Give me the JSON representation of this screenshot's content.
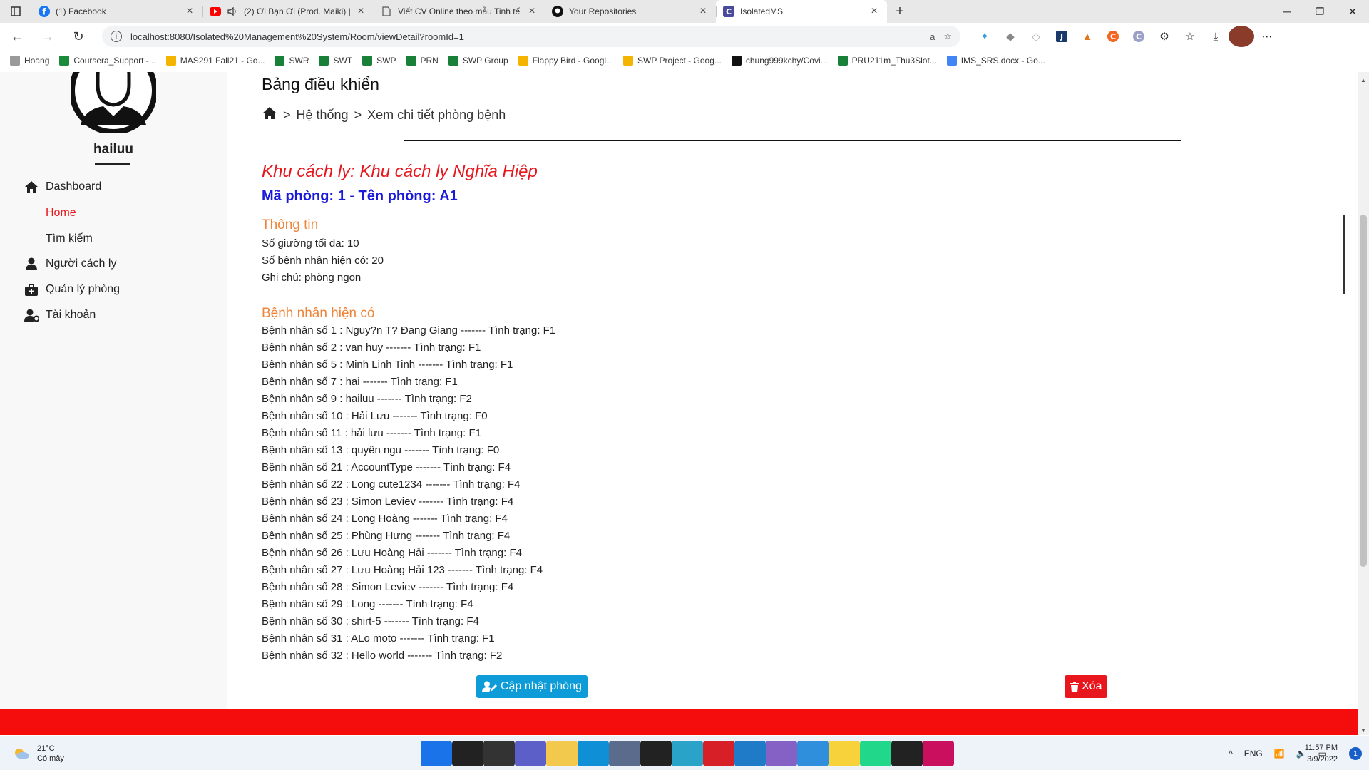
{
  "browser": {
    "tabs": [
      {
        "title": "(1) Facebook",
        "icon": "facebook-icon",
        "color": "#1877f2"
      },
      {
        "title": "(2) Ơi Bạn Ơi (Prod. Maiki) |",
        "icon": "youtube-icon",
        "color": "#ff0000"
      },
      {
        "title": "Viết CV Online theo mẫu Tinh tế",
        "icon": "page-icon",
        "color": "#555555"
      },
      {
        "title": "Your Repositories",
        "icon": "github-icon",
        "color": "#111111"
      },
      {
        "title": "IsolatedMS",
        "icon": "isolatedms-icon",
        "color": "#4a4a9c"
      }
    ],
    "url": "localhost:8080/Isolated%20Management%20System/Room/viewDetail?roomId=1",
    "bookmarks": [
      {
        "label": "Hoang",
        "color": "#999999"
      },
      {
        "label": "Coursera_Support -...",
        "color": "#1b8a3a"
      },
      {
        "label": "MAS291 Fall21 - Go...",
        "color": "#f4b400"
      },
      {
        "label": "SWR",
        "color": "#188038"
      },
      {
        "label": "SWT",
        "color": "#188038"
      },
      {
        "label": "SWP",
        "color": "#188038"
      },
      {
        "label": "PRN",
        "color": "#188038"
      },
      {
        "label": "SWP Group",
        "color": "#188038"
      },
      {
        "label": "Flappy Bird - Googl...",
        "color": "#f4b400"
      },
      {
        "label": "SWP Project - Goog...",
        "color": "#f4b400"
      },
      {
        "label": "chung999kchy/Covi...",
        "color": "#111111"
      },
      {
        "label": "PRU211m_Thu3Slot...",
        "color": "#188038"
      },
      {
        "label": "IMS_SRS.docx - Go...",
        "color": "#4285f4"
      }
    ]
  },
  "sidebar": {
    "username": "hailuu",
    "items": [
      {
        "label": "Dashboard",
        "icon": "home-icon"
      },
      {
        "label": "Người cách ly",
        "icon": "person-icon"
      },
      {
        "label": "Quản lý phòng",
        "icon": "medkit-icon"
      },
      {
        "label": "Tài khoản",
        "icon": "user-gear-icon"
      }
    ],
    "sub_items": [
      {
        "label": "Home",
        "active": true
      },
      {
        "label": "Tìm kiếm",
        "active": false
      }
    ]
  },
  "main": {
    "heading": "Bảng điều khiển",
    "breadcrumb": [
      "Hệ thống",
      "Xem chi tiết phòng bệnh"
    ],
    "zone": "Khu cách ly: Khu cách ly Nghĩa Hiệp",
    "room_line": "Mã phòng: 1 - Tên phòng: A1",
    "info_title": "Thông tin",
    "max_beds": "Số giường tối đa: 10",
    "current_count": "Số bệnh nhân hiện có: 20",
    "note": "Ghi chú: phòng ngon",
    "patients_title": "Bệnh nhân hiện có",
    "patients": [
      "Bệnh nhân số 1 : Nguy?n T? Đang Giang ------- Tình trạng: F1",
      "Bệnh nhân số 2 : van huy ------- Tình trạng: F1",
      "Bệnh nhân số 5 : Minh Linh Tinh ------- Tình trạng: F1",
      "Bệnh nhân số 7 : hai ------- Tình trạng: F1",
      "Bệnh nhân số 9 : hailuu ------- Tình trạng: F2",
      "Bệnh nhân số 10 : Hải Lưu ------- Tình trạng: F0",
      "Bệnh nhân số 11 : hải lưu ------- Tình trạng: F1",
      "Bệnh nhân số 13 : quyên ngu ------- Tình trạng: F0",
      "Bệnh nhân số 21 : AccountType ------- Tình trạng: F4",
      "Bệnh nhân số 22 : Long cute1234 ------- Tình trạng: F4",
      "Bệnh nhân số 23 : Simon Leviev ------- Tình trạng: F4",
      "Bệnh nhân số 24 : Long Hoàng ------- Tình trạng: F4",
      "Bệnh nhân số 25 : Phùng Hưng ------- Tình trạng: F4",
      "Bệnh nhân số 26 : Lưu Hoàng Hải ------- Tình trạng: F4",
      "Bệnh nhân số 27 : Lưu Hoàng Hải 123 ------- Tình trạng: F4",
      "Bệnh nhân số 28 : Simon Leviev ------- Tình trạng: F4",
      "Bệnh nhân số 29 : Long ------- Tình trạng: F4",
      "Bệnh nhân số 30 : shirt-5 ------- Tình trạng: F4",
      "Bệnh nhân số 31 : ALo moto ------- Tình trạng: F1",
      "Bệnh nhân số 32 : Hello world ------- Tình trạng: F2"
    ],
    "update_button": "Cập nhật phòng",
    "delete_button": "Xóa"
  },
  "taskbar": {
    "temperature": "21°C",
    "weather": "Có mây",
    "language": "ENG",
    "time": "11:57 PM",
    "date": "3/9/2022",
    "notifications": "1",
    "apps": [
      {
        "name": "start-icon",
        "color": "#1a73e8"
      },
      {
        "name": "search-icon",
        "color": "#222222"
      },
      {
        "name": "task-view-icon",
        "color": "#333333"
      },
      {
        "name": "teams-chat-icon",
        "color": "#5b5fc7"
      },
      {
        "name": "file-explorer-icon",
        "color": "#f2c94c"
      },
      {
        "name": "edge-icon",
        "color": "#0f8fd6"
      },
      {
        "name": "security-icon",
        "color": "#5a6b8c"
      },
      {
        "name": "unity-icon",
        "color": "#222222"
      },
      {
        "name": "snip-icon",
        "color": "#2aa3c9"
      },
      {
        "name": "redhat-icon",
        "color": "#d61f26"
      },
      {
        "name": "vscode-icon",
        "color": "#1f7ac8"
      },
      {
        "name": "visual-studio-icon",
        "color": "#8661c5"
      },
      {
        "name": "todo-icon",
        "color": "#2f8fdc"
      },
      {
        "name": "sticky-notes-icon",
        "color": "#f7d23b"
      },
      {
        "name": "pycharm-icon",
        "color": "#21d789"
      },
      {
        "name": "unity-hub-icon",
        "color": "#222222"
      },
      {
        "name": "rider-icon",
        "color": "#c90f5e"
      }
    ]
  },
  "colors": {
    "accent_red": "#e8171e",
    "room_blue": "#1a1adb",
    "section_orange": "#f0853a",
    "button_blue": "#0d9cd8"
  }
}
